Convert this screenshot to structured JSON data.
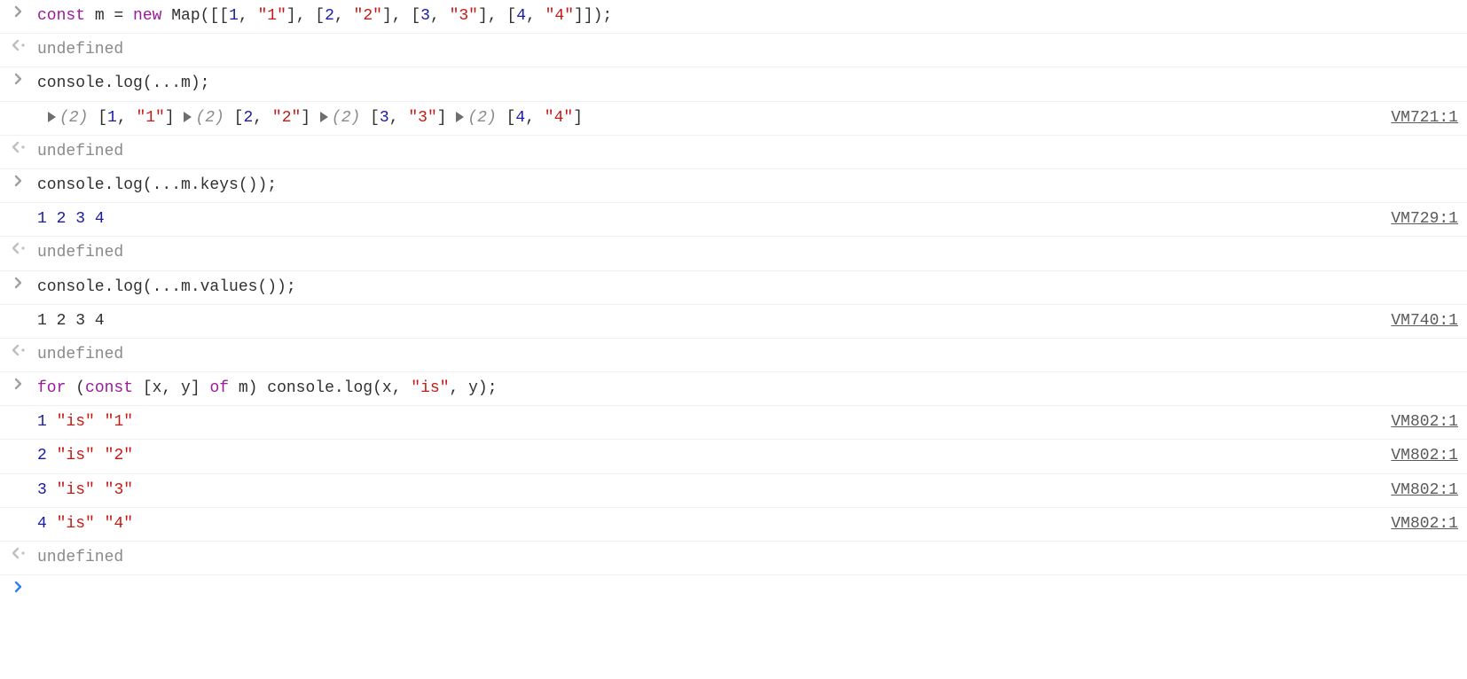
{
  "lines": [
    {
      "kind": "input",
      "tokens": [
        {
          "t": "const",
          "c": "kw"
        },
        {
          "t": " m "
        },
        {
          "t": "= "
        },
        {
          "t": "new",
          "c": "kw"
        },
        {
          "t": " Map([["
        },
        {
          "t": "1",
          "c": "num"
        },
        {
          "t": ", "
        },
        {
          "t": "\"1\"",
          "c": "str"
        },
        {
          "t": "], ["
        },
        {
          "t": "2",
          "c": "num"
        },
        {
          "t": ", "
        },
        {
          "t": "\"2\"",
          "c": "str"
        },
        {
          "t": "], ["
        },
        {
          "t": "3",
          "c": "num"
        },
        {
          "t": ", "
        },
        {
          "t": "\"3\"",
          "c": "str"
        },
        {
          "t": "], ["
        },
        {
          "t": "4",
          "c": "num"
        },
        {
          "t": ", "
        },
        {
          "t": "\"4\"",
          "c": "str"
        },
        {
          "t": "]]);"
        }
      ]
    },
    {
      "kind": "return",
      "tokens": [
        {
          "t": "undefined",
          "c": "undef"
        }
      ]
    },
    {
      "kind": "input",
      "tokens": [
        {
          "t": "console.log(...m);"
        }
      ]
    },
    {
      "kind": "log",
      "indent": true,
      "source": "VM721:1",
      "tokens": [
        {
          "arrow": true
        },
        {
          "t": "(2)",
          "c": "gray-italic"
        },
        {
          "t": " ["
        },
        {
          "t": "1",
          "c": "num"
        },
        {
          "t": ", "
        },
        {
          "t": "\"1\"",
          "c": "str"
        },
        {
          "t": "] "
        },
        {
          "arrow": true
        },
        {
          "t": "(2)",
          "c": "gray-italic"
        },
        {
          "t": " ["
        },
        {
          "t": "2",
          "c": "num"
        },
        {
          "t": ", "
        },
        {
          "t": "\"2\"",
          "c": "str"
        },
        {
          "t": "] "
        },
        {
          "arrow": true
        },
        {
          "t": "(2)",
          "c": "gray-italic"
        },
        {
          "t": " ["
        },
        {
          "t": "3",
          "c": "num"
        },
        {
          "t": ", "
        },
        {
          "t": "\"3\"",
          "c": "str"
        },
        {
          "t": "] "
        },
        {
          "arrow": true
        },
        {
          "t": "(2)",
          "c": "gray-italic"
        },
        {
          "t": " ["
        },
        {
          "t": "4",
          "c": "num"
        },
        {
          "t": ", "
        },
        {
          "t": "\"4\"",
          "c": "str"
        },
        {
          "t": "]"
        }
      ]
    },
    {
      "kind": "return",
      "tokens": [
        {
          "t": "undefined",
          "c": "undef"
        }
      ]
    },
    {
      "kind": "input",
      "tokens": [
        {
          "t": "console.log(...m.keys());"
        }
      ]
    },
    {
      "kind": "log",
      "source": "VM729:1",
      "tokens": [
        {
          "t": "1",
          "c": "num"
        },
        {
          "t": " "
        },
        {
          "t": "2",
          "c": "num"
        },
        {
          "t": " "
        },
        {
          "t": "3",
          "c": "num"
        },
        {
          "t": " "
        },
        {
          "t": "4",
          "c": "num"
        }
      ]
    },
    {
      "kind": "return",
      "tokens": [
        {
          "t": "undefined",
          "c": "undef"
        }
      ]
    },
    {
      "kind": "input",
      "tokens": [
        {
          "t": "console.log(...m.values());"
        }
      ]
    },
    {
      "kind": "log",
      "source": "VM740:1",
      "tokens": [
        {
          "t": "1 2 3 4"
        }
      ]
    },
    {
      "kind": "return",
      "tokens": [
        {
          "t": "undefined",
          "c": "undef"
        }
      ]
    },
    {
      "kind": "input",
      "tokens": [
        {
          "t": "for",
          "c": "kw"
        },
        {
          "t": " ("
        },
        {
          "t": "const",
          "c": "kw"
        },
        {
          "t": " [x, y] "
        },
        {
          "t": "of",
          "c": "kw"
        },
        {
          "t": " m) console.log(x, "
        },
        {
          "t": "\"is\"",
          "c": "str"
        },
        {
          "t": ", y);"
        }
      ]
    },
    {
      "kind": "log",
      "source": "VM802:1",
      "tokens": [
        {
          "t": "1",
          "c": "num"
        },
        {
          "t": " "
        },
        {
          "t": "\"is\"",
          "c": "str"
        },
        {
          "t": " "
        },
        {
          "t": "\"1\"",
          "c": "str"
        }
      ]
    },
    {
      "kind": "log",
      "source": "VM802:1",
      "tokens": [
        {
          "t": "2",
          "c": "num"
        },
        {
          "t": " "
        },
        {
          "t": "\"is\"",
          "c": "str"
        },
        {
          "t": " "
        },
        {
          "t": "\"2\"",
          "c": "str"
        }
      ]
    },
    {
      "kind": "log",
      "source": "VM802:1",
      "tokens": [
        {
          "t": "3",
          "c": "num"
        },
        {
          "t": " "
        },
        {
          "t": "\"is\"",
          "c": "str"
        },
        {
          "t": " "
        },
        {
          "t": "\"3\"",
          "c": "str"
        }
      ]
    },
    {
      "kind": "log",
      "source": "VM802:1",
      "tokens": [
        {
          "t": "4",
          "c": "num"
        },
        {
          "t": " "
        },
        {
          "t": "\"is\"",
          "c": "str"
        },
        {
          "t": " "
        },
        {
          "t": "\"4\"",
          "c": "str"
        }
      ]
    },
    {
      "kind": "return",
      "tokens": [
        {
          "t": "undefined",
          "c": "undef"
        }
      ]
    },
    {
      "kind": "prompt"
    }
  ],
  "icons": {
    "input_color": "#a0a0a0",
    "return_color": "#bfbfbf",
    "prompt_color": "#367cf1"
  }
}
